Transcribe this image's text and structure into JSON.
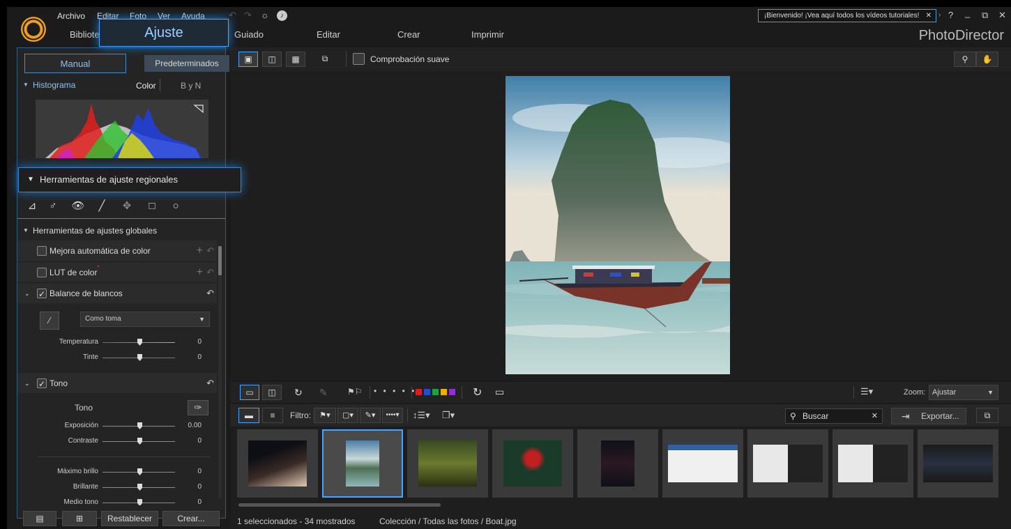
{
  "menubar": {
    "items": [
      "Archivo",
      "Editar",
      "Foto",
      "Ver",
      "Ayuda"
    ],
    "welcome": "¡Bienvenido! ¡Vea aquí todos los vídeos tutoriales!",
    "help": "?",
    "brand": "PhotoDirector"
  },
  "modes": {
    "library": "Bibliote",
    "active": "Ajuste",
    "guided": "Guiado",
    "edit": "Editar",
    "create": "Crear",
    "print": "Imprimir"
  },
  "left_panel": {
    "tab_manual": "Manual",
    "tab_presets": "Predeterminados",
    "histogram": "Histograma",
    "hist_color": "Color",
    "hist_bw": "B y N",
    "regional_tools": "Herramientas de ajuste regionales",
    "global_tools": "Herramientas de ajustes globales",
    "auto_color": "Mejora automática de color",
    "lut": "LUT de color",
    "lut_mark": "*",
    "white_balance": "Balance de blancos",
    "wb_mode": "Como toma",
    "temperature_label": "Temperatura",
    "temperature_value": "0",
    "tint_label": "Tinte",
    "tint_value": "0",
    "tone_section": "Tono",
    "tone_sub": "Tono",
    "exposure_label": "Exposición",
    "exposure_value": "0.00",
    "contrast_label": "Contraste",
    "contrast_value": "0",
    "highlights_label": "Máximo brillo",
    "highlights_value": "0",
    "bright_label": "Brillante",
    "bright_value": "0",
    "midtone_label": "Medio tono",
    "midtone_value": "0",
    "reset": "Restablecer",
    "create": "Crear..."
  },
  "toolbar": {
    "soft_proof": "Comprobación suave"
  },
  "strip": {
    "zoom_label": "Zoom:",
    "zoom_value": "Ajustar",
    "filter_label": "Filtro:",
    "search_placeholder": "Buscar",
    "export": "Exportar...",
    "color_labels": [
      "#d42020",
      "#2050d0",
      "#20a040",
      "#e8b000",
      "#9030d0"
    ]
  },
  "status": {
    "selection": "1 seleccionados - 34 mostrados",
    "path": "Colección / Todas las fotos / Boat.jpg"
  }
}
